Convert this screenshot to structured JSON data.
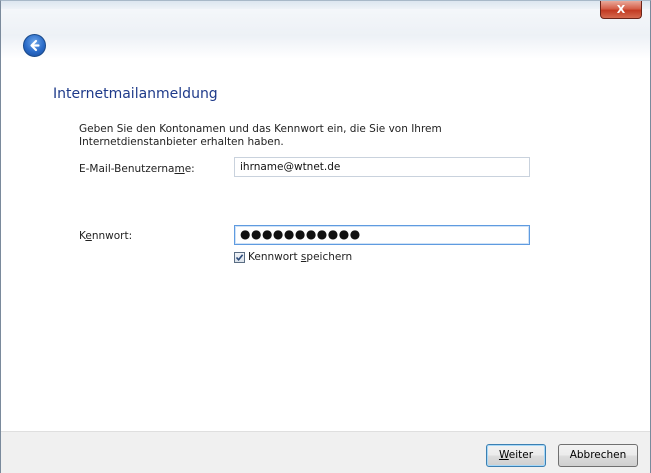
{
  "window": {
    "close_label": "X"
  },
  "page": {
    "heading": "Internetmailanmeldung",
    "intro": "Geben Sie den Kontonamen und das Kennwort ein, die Sie von Ihrem Internetdienstanbieter erhalten haben."
  },
  "form": {
    "username_label_pre": "E-Mail-Benutzerna",
    "username_label_mnemonic": "m",
    "username_label_post": "e:",
    "username_value": "ihrname@wtnet.de",
    "password_label_pre": "K",
    "password_label_mnemonic": "e",
    "password_label_post": "nnwort:",
    "password_value": "●●●●●●●●●●●",
    "remember_pre": "Kennwort ",
    "remember_mnemonic": "s",
    "remember_post": "peichern",
    "remember_checked": true
  },
  "footer": {
    "next_mnemonic": "W",
    "next_post": "eiter",
    "cancel_label": "Abbrechen"
  },
  "colors": {
    "heading": "#1e3a8a",
    "close_button": "#c23a22",
    "back_button": "#2a6bc8"
  }
}
